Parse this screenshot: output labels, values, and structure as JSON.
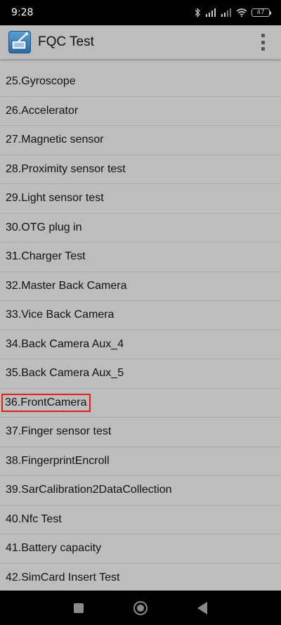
{
  "status_bar": {
    "time": "9:28",
    "battery": "47"
  },
  "app_bar": {
    "title": "FQC Test"
  },
  "list": {
    "items": [
      {
        "label": "25.Gyroscope"
      },
      {
        "label": "26.Accelerator"
      },
      {
        "label": "27.Magnetic sensor"
      },
      {
        "label": "28.Proximity sensor test"
      },
      {
        "label": "29.Light sensor test"
      },
      {
        "label": "30.OTG plug in"
      },
      {
        "label": "31.Charger Test"
      },
      {
        "label": "32.Master Back Camera"
      },
      {
        "label": "33.Vice Back Camera"
      },
      {
        "label": "34.Back Camera Aux_4"
      },
      {
        "label": "35.Back Camera Aux_5"
      },
      {
        "label": "36.FrontCamera",
        "highlighted": true
      },
      {
        "label": "37.Finger sensor test"
      },
      {
        "label": "38.FingerprintEncroll"
      },
      {
        "label": "39.SarCalibration2DataCollection"
      },
      {
        "label": "40.Nfc Test"
      },
      {
        "label": "41.Battery capacity"
      },
      {
        "label": "42.SimCard Insert Test"
      }
    ]
  },
  "colors": {
    "background": "#bdbdbd",
    "divider": "#a9a9a9",
    "highlight_border": "#e0201f"
  }
}
